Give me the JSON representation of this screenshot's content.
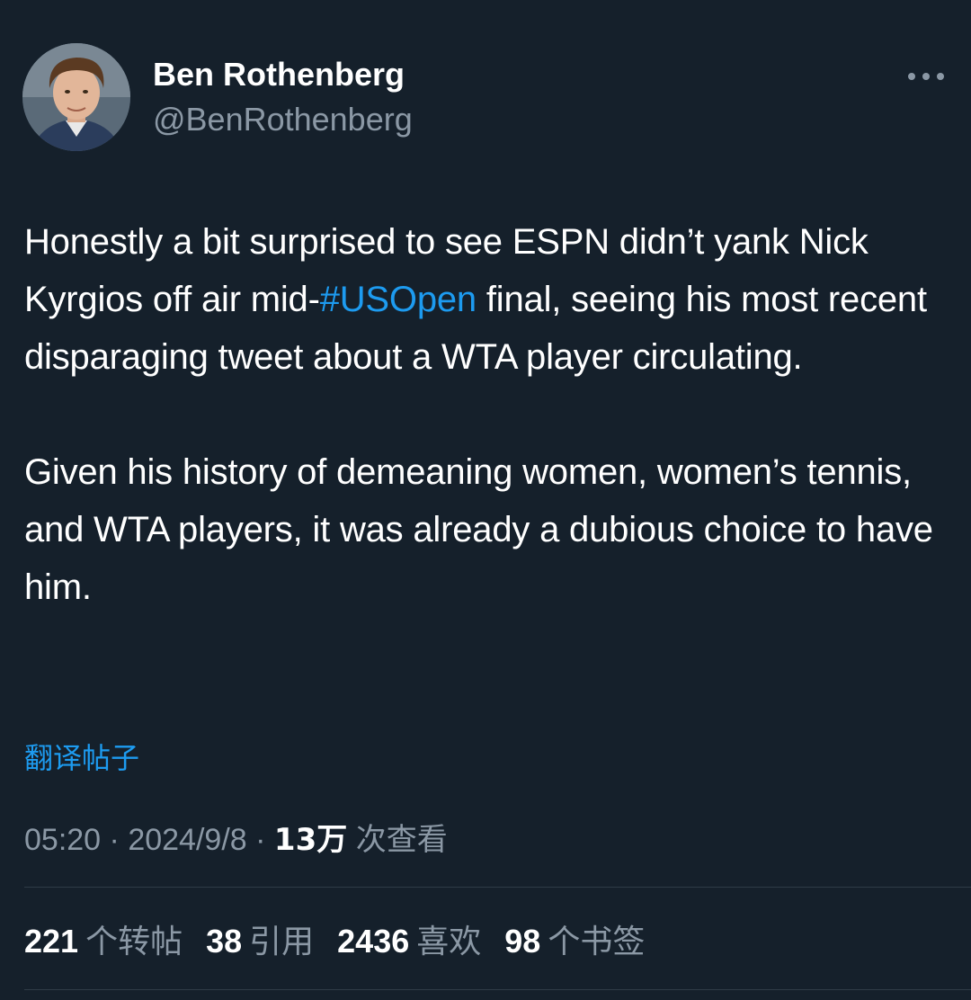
{
  "author": {
    "name": "Ben Rothenberg",
    "handle": "@BenRothenberg"
  },
  "tweet": {
    "line1_before": "Honestly a bit surprised to see ESPN didn’t yank Nick Kyrgios off air mid-",
    "hashtag": "#USOpen",
    "line1_after": " final, seeing his most recent disparaging tweet about a WTA player circulating.",
    "paragraph2": "Given his history of demeaning women, women’s tennis, and WTA players, it was already a dubious choice to have him."
  },
  "translate_label": "翻译帖子",
  "meta": {
    "time": "05:20",
    "separator": "·",
    "date": "2024/9/8",
    "views_count": "13万",
    "views_label": "次查看"
  },
  "stats": {
    "reposts": {
      "count": "221",
      "label": "个转帖"
    },
    "quotes": {
      "count": "38",
      "label": "引用"
    },
    "likes": {
      "count": "2436",
      "label": "喜欢"
    },
    "bookmarks": {
      "count": "98",
      "label": "个书签"
    }
  },
  "icons": {
    "more": "more-horizontal-icon"
  },
  "colors": {
    "background": "#15202b",
    "link": "#1d9bf0",
    "secondary_text": "#8b98a5",
    "primary_text": "#ffffff"
  }
}
